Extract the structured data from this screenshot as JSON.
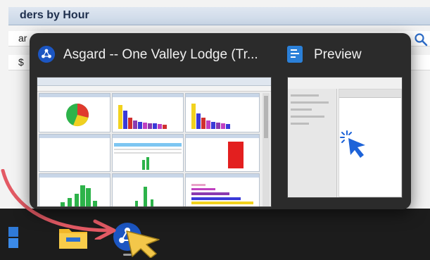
{
  "background_app": {
    "header_title": "ders by Hour",
    "row1_text": "ar",
    "row2_text": "$"
  },
  "flyout": {
    "cards": [
      {
        "title": "Asgard -- One Valley Lodge (Tr...",
        "icon": "asgard-app-icon"
      },
      {
        "title": "Preview",
        "icon": "preview-app-icon"
      }
    ]
  },
  "taskbar": {
    "items": [
      {
        "name": "start-button",
        "icon": "windows-logo-icon"
      },
      {
        "name": "file-explorer",
        "icon": "folder-icon"
      },
      {
        "name": "asgard",
        "icon": "asgard-app-icon",
        "active": true
      }
    ]
  },
  "colors": {
    "taskbar": "#1c1c1c",
    "flyout": "#2b2b2b",
    "accent_blue": "#1c56c2",
    "annotation_arrow": "#e35a64",
    "pointer": "#f3c74a"
  }
}
